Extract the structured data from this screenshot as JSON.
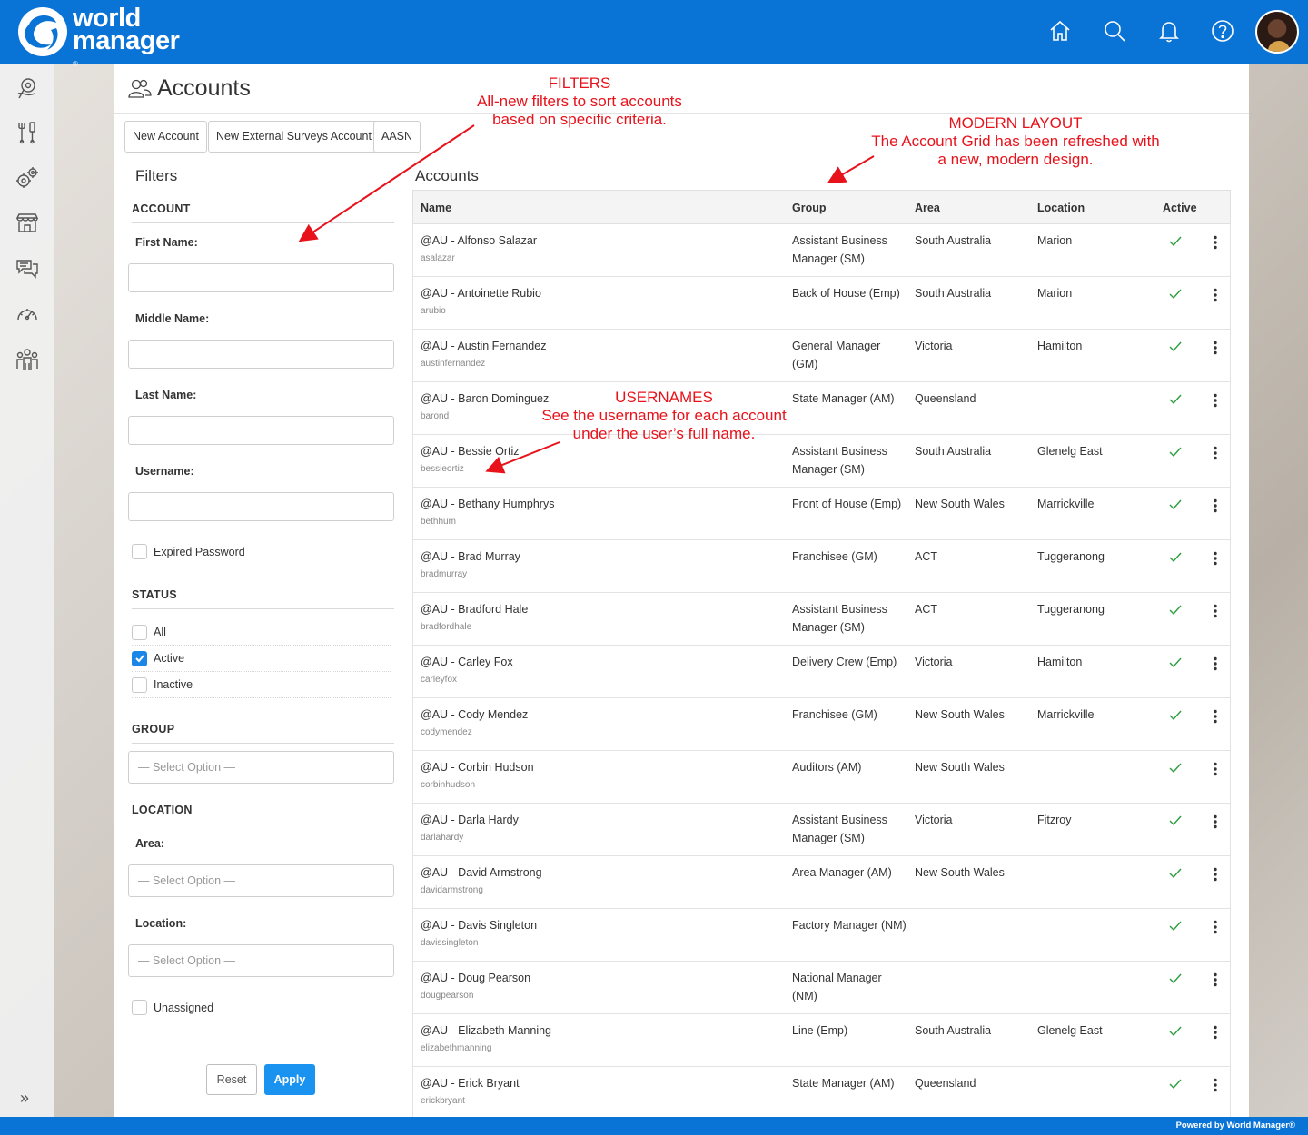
{
  "brand": {
    "line1": "world",
    "line2": "manager",
    "reg": "®"
  },
  "colors": {
    "brand_blue": "#0a73d6",
    "accent_blue": "#1a93f0",
    "annotation_red": "#e8121b",
    "check_green": "#2a9d3c"
  },
  "topbar": {
    "icons": [
      "home-icon",
      "search-icon",
      "bell-icon",
      "help-icon"
    ]
  },
  "sidebar": {
    "icons": [
      "map-pin-icon",
      "tools-icon",
      "gears-icon",
      "store-icon",
      "chat-icon",
      "speedometer-icon",
      "people-icon"
    ],
    "expand": "»"
  },
  "page": {
    "title": "Accounts"
  },
  "toolbar": {
    "new_account": "New Account",
    "new_external": "New External Surveys Account",
    "aasn": "AASN"
  },
  "filters": {
    "title": "Filters",
    "account_heading": "ACCOUNT",
    "first_name": "First Name:",
    "middle_name": "Middle Name:",
    "last_name": "Last Name:",
    "username": "Username:",
    "expired_password": "Expired Password",
    "status_heading": "STATUS",
    "status_all": "All",
    "status_active": "Active",
    "status_inactive": "Inactive",
    "group_heading": "GROUP",
    "location_heading": "LOCATION",
    "area_label": "Area:",
    "location_label": "Location:",
    "select_placeholder": "— Select Option —",
    "unassigned": "Unassigned",
    "reset": "Reset",
    "apply": "Apply"
  },
  "grid": {
    "title": "Accounts",
    "columns": [
      "Name",
      "Group",
      "Area",
      "Location",
      "Active"
    ],
    "rows": [
      {
        "name": "@AU - Alfonso Salazar",
        "username": "asalazar",
        "group": "Assistant Business Manager (SM)",
        "area": "South Australia",
        "location": "Marion",
        "active": true
      },
      {
        "name": "@AU - Antoinette Rubio",
        "username": "arubio",
        "group": "Back of House (Emp)",
        "area": "South Australia",
        "location": "Marion",
        "active": true
      },
      {
        "name": "@AU - Austin Fernandez",
        "username": "austinfernandez",
        "group": "General Manager (GM)",
        "area": "Victoria",
        "location": "Hamilton",
        "active": true
      },
      {
        "name": "@AU - Baron Dominguez",
        "username": "barond",
        "group": "State Manager (AM)",
        "area": "Queensland",
        "location": "",
        "active": true
      },
      {
        "name": "@AU - Bessie Ortiz",
        "username": "bessieortiz",
        "group": "Assistant Business Manager (SM)",
        "area": "South Australia",
        "location": "Glenelg East",
        "active": true
      },
      {
        "name": "@AU - Bethany Humphrys",
        "username": "bethhum",
        "group": "Front of House (Emp)",
        "area": "New South Wales",
        "location": "Marrickville",
        "active": true
      },
      {
        "name": "@AU - Brad Murray",
        "username": "bradmurray",
        "group": "Franchisee (GM)",
        "area": "ACT",
        "location": "Tuggeranong",
        "active": true
      },
      {
        "name": "@AU - Bradford Hale",
        "username": "bradfordhale",
        "group": "Assistant Business Manager (SM)",
        "area": "ACT",
        "location": "Tuggeranong",
        "active": true
      },
      {
        "name": "@AU - Carley Fox",
        "username": "carleyfox",
        "group": "Delivery Crew (Emp)",
        "area": "Victoria",
        "location": "Hamilton",
        "active": true
      },
      {
        "name": "@AU - Cody Mendez",
        "username": "codymendez",
        "group": "Franchisee (GM)",
        "area": "New South Wales",
        "location": "Marrickville",
        "active": true
      },
      {
        "name": "@AU - Corbin Hudson",
        "username": "corbinhudson",
        "group": "Auditors (AM)",
        "area": "New South Wales",
        "location": "",
        "active": true
      },
      {
        "name": "@AU - Darla Hardy",
        "username": "darlahardy",
        "group": "Assistant Business Manager (SM)",
        "area": "Victoria",
        "location": "Fitzroy",
        "active": true
      },
      {
        "name": "@AU - David Armstrong",
        "username": "davidarmstrong",
        "group": "Area Manager (AM)",
        "area": "New South Wales",
        "location": "",
        "active": true
      },
      {
        "name": "@AU - Davis Singleton",
        "username": "davissingleton",
        "group": "Factory Manager (NM)",
        "area": "",
        "location": "",
        "active": true
      },
      {
        "name": "@AU - Doug Pearson",
        "username": "dougpearson",
        "group": "National Manager (NM)",
        "area": "",
        "location": "",
        "active": true
      },
      {
        "name": "@AU - Elizabeth Manning",
        "username": "elizabethmanning",
        "group": "Line (Emp)",
        "area": "South Australia",
        "location": "Glenelg East",
        "active": true
      },
      {
        "name": "@AU - Erick Bryant",
        "username": "erickbryant",
        "group": "State Manager (AM)",
        "area": "Queensland",
        "location": "",
        "active": true
      }
    ]
  },
  "annotations": {
    "filters": {
      "title": "FILTERS",
      "line1": "All-new filters to sort accounts",
      "line2": "based on specific criteria."
    },
    "layout": {
      "title": "MODERN LAYOUT",
      "line1": "The Account Grid has been refreshed with",
      "line2": "a new, modern design."
    },
    "usernames": {
      "title": "USERNAMES",
      "line1": "See the username for each account",
      "line2": "under the user’s full name."
    }
  },
  "footer": {
    "powered": "Powered by World Manager®"
  }
}
